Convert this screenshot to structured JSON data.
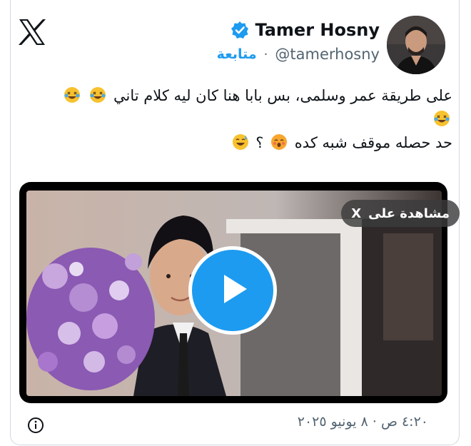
{
  "author": {
    "name": "Tamer Hosny",
    "handle": "@tamerhosny",
    "follow_label": "متابعة",
    "separator": "·"
  },
  "tweet": {
    "line1": "على طريقة عمر وسلمى، بس بابا هنا كان ليه كلام تاني",
    "line2": "حد حصله موقف شبه كده",
    "line2_qmark": "؟"
  },
  "media": {
    "watch_label": "مشاهدة على",
    "watch_x": "X"
  },
  "footer": {
    "timestamp": "٤:٢٠ ص · ٨ يونيو ٢٠٢٥"
  },
  "icons": {
    "brand": "x-logo-icon",
    "verified": "verified-badge-icon",
    "play": "play-icon",
    "info": "info-icon",
    "emoji_laugh": "rolling-on-floor-laughing-emoji",
    "emoji_shy": "face-exhaling-shy-emoji",
    "emoji_sweat": "grinning-sweat-emoji"
  },
  "colors": {
    "accent": "#1d9bf0",
    "text": "#0f1419",
    "muted": "#536471"
  }
}
